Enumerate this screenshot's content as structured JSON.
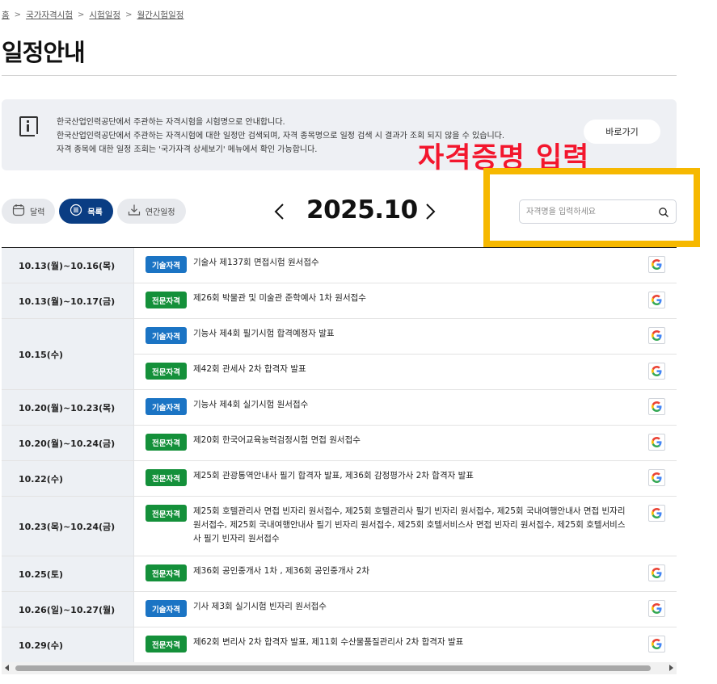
{
  "breadcrumb": [
    "홈",
    "국가자격시험",
    "시험일정",
    "월간시험일정"
  ],
  "page_title": "일정안내",
  "notice": {
    "lines": [
      "한국산업인력공단에서 주관하는 자격시험을 시험명으로 안내합니다.",
      "한국산업인력공단에서 주관하는 자격시험에 대한 일정만 검색되며, 자격 종목명으로 일정 검색 시 결과가 조회 되지 않을 수 있습니다.",
      "자격 종목에 대한 일정 조회는 '국가자격 상세보기' 메뉴에서 확인 가능합니다."
    ],
    "button_label": "바로가기"
  },
  "overlay_label": "자격증명 입력",
  "colors": {
    "overlay_text": "#f3162d",
    "overlay_box": "#f6b800",
    "tech_badge": "#1b74c4",
    "pro_badge": "#14903a",
    "active_tab": "#0a3d83"
  },
  "view_tabs": [
    {
      "label": "달력",
      "icon": "calendar-icon",
      "active": false
    },
    {
      "label": "목록",
      "icon": "list-icon",
      "active": true
    },
    {
      "label": "연간일정",
      "icon": "download-icon",
      "active": false
    }
  ],
  "month_label": "2025.10",
  "search": {
    "placeholder": "자격명을 입력하세요",
    "value": ""
  },
  "schedule": [
    {
      "date": "10.13(월)~10.16(목)",
      "events": [
        {
          "badge": "기술자격",
          "type": "tech",
          "title": "기술사 제137회 면접시험 원서접수"
        }
      ]
    },
    {
      "date": "10.13(월)~10.17(금)",
      "events": [
        {
          "badge": "전문자격",
          "type": "pro",
          "title": "제26회 박물관 및 미술관 준학예사 1차 원서접수"
        }
      ]
    },
    {
      "date": "10.15(수)",
      "events": [
        {
          "badge": "기술자격",
          "type": "tech",
          "title": "기능사 제4회 필기시험 합격예정자 발표"
        },
        {
          "badge": "전문자격",
          "type": "pro",
          "title": "제42회 관세사 2차 합격자 발표"
        }
      ]
    },
    {
      "date": "10.20(월)~10.23(목)",
      "events": [
        {
          "badge": "기술자격",
          "type": "tech",
          "title": "기능사 제4회 실기시험 원서접수"
        }
      ]
    },
    {
      "date": "10.20(월)~10.24(금)",
      "events": [
        {
          "badge": "전문자격",
          "type": "pro",
          "title": "제20회 한국어교육능력검정시험 면접 원서접수"
        }
      ]
    },
    {
      "date": "10.22(수)",
      "events": [
        {
          "badge": "전문자격",
          "type": "pro",
          "title": "제25회 관광통역안내사 필기 합격자 발표, 제36회 감정평가사 2차 합격자 발표"
        }
      ]
    },
    {
      "date": "10.23(목)~10.24(금)",
      "events": [
        {
          "badge": "전문자격",
          "type": "pro",
          "title": "제25회 호텔관리사 면접 빈자리 원서접수, 제25회 호텔관리사 필기 빈자리 원서접수, 제25회 국내여행안내사 면접 빈자리 원서접수, 제25회 국내여행안내사 필기 빈자리 원서접수, 제25회 호텔서비스사 면접 빈자리 원서접수, 제25회 호텔서비스사 필기 빈자리 원서접수"
        }
      ]
    },
    {
      "date": "10.25(토)",
      "events": [
        {
          "badge": "전문자격",
          "type": "pro",
          "title": "제36회 공인중개사 1차 , 제36회 공인중개사 2차"
        }
      ]
    },
    {
      "date": "10.26(일)~10.27(월)",
      "events": [
        {
          "badge": "기술자격",
          "type": "tech",
          "title": "기사 제3회 실기시험 빈자리 원서접수"
        }
      ]
    },
    {
      "date": "10.29(수)",
      "events": [
        {
          "badge": "전문자격",
          "type": "pro",
          "title": "제62회 변리사 2차 합격자 발표, 제11회 수산물품질관리사 2차 합격자 발표"
        }
      ]
    }
  ]
}
